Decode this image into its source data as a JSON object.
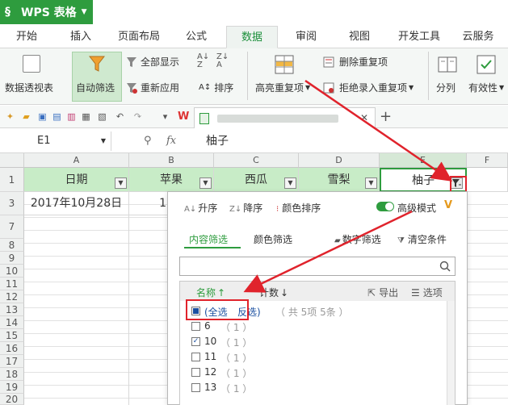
{
  "app": {
    "title": "WPS 表格"
  },
  "tabs": [
    "开始",
    "插入",
    "页面布局",
    "公式",
    "数据",
    "审阅",
    "视图",
    "开发工具",
    "云服务"
  ],
  "ribbon": {
    "pivot": "数据透视表",
    "autofilter": "自动筛选",
    "show_all": "全部显示",
    "reapply": "重新应用",
    "sort": "排序",
    "highlight_dup": "高亮重复项",
    "remove_dup": "删除重复项",
    "reject_dup": "拒绝录入重复项",
    "split": "分列",
    "validity": "有效性"
  },
  "formula_bar": {
    "name_box": "E1",
    "content": "柚子"
  },
  "columns": [
    "A",
    "B",
    "C",
    "D",
    "E",
    "F"
  ],
  "rows": [
    "1",
    "3",
    "7",
    "8",
    "9",
    "10",
    "11",
    "12",
    "13",
    "14",
    "15",
    "16",
    "17",
    "18",
    "19",
    "20"
  ],
  "header_row": {
    "A": "日期",
    "B": "苹果",
    "C": "西瓜",
    "D": "雪梨",
    "E": "柚子"
  },
  "row3": {
    "A": "2017年10月28日",
    "B": "1"
  },
  "filter_panel": {
    "sort_asc": "升序",
    "sort_desc": "降序",
    "color_sort": "颜色排序",
    "advanced_mode": "高级模式",
    "tab_content": "内容筛选",
    "tab_color": "颜色筛选",
    "number_filter": "数字筛选",
    "clear": "清空条件",
    "col_name": "名称",
    "col_count": "计数",
    "export": "导出",
    "options": "选项",
    "select_all": "(全选",
    "invert": "反选)",
    "summary": "（ 共 5项 5条 ）",
    "items": [
      {
        "label": "6",
        "count": "（ 1 ）",
        "checked": false
      },
      {
        "label": "10",
        "count": "（ 1 ）",
        "checked": true
      },
      {
        "label": "11",
        "count": "（ 1 ）",
        "checked": false
      },
      {
        "label": "12",
        "count": "（ 1 ）",
        "checked": false
      },
      {
        "label": "13",
        "count": "（ 1 ）",
        "checked": false
      }
    ]
  },
  "colors": {
    "accent": "#2e9c3e",
    "highlight": "#e0232c",
    "header_fill": "#c8ecc7"
  }
}
